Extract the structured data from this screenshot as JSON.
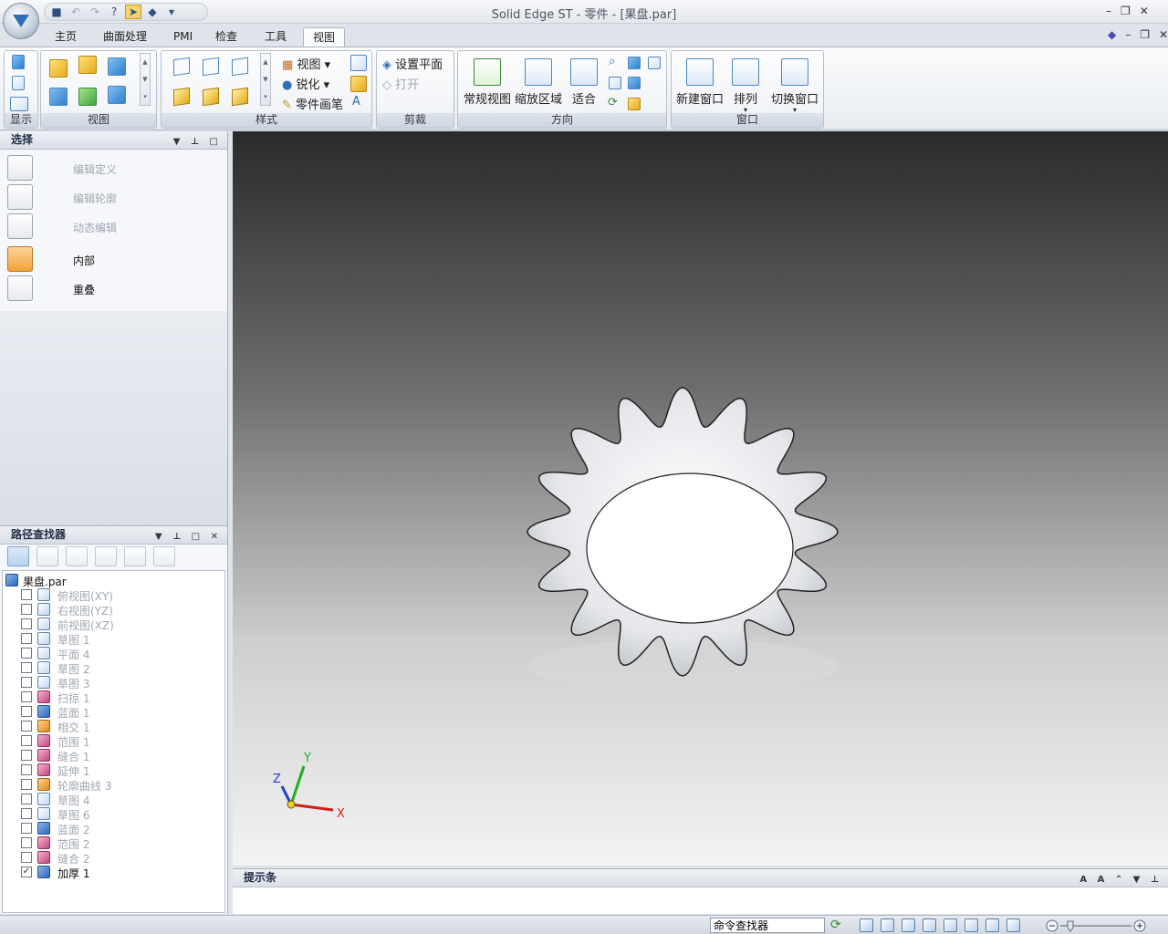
{
  "window": {
    "title": "Solid Edge ST - 零件 - [果盘.par]"
  },
  "tabs": [
    "主页",
    "曲面处理",
    "PMI",
    "检查",
    "工具",
    "视图"
  ],
  "active_tab": "视图",
  "ribbon": {
    "groups": {
      "display": "显示",
      "views": "视图",
      "styles": "样式",
      "clip": "剪裁",
      "orient": "方向",
      "window": "窗口"
    },
    "styles_buttons": {
      "view": "视图",
      "sharpen": "锐化",
      "part_painter": "零件画笔"
    },
    "clip_buttons": {
      "set_plane": "设置平面",
      "open": "打开"
    },
    "orient_buttons": {
      "common_views": "常规视图",
      "zoom_area": "缩放区域",
      "fit": "适合"
    },
    "window_buttons": {
      "new_window": "新建窗口",
      "arrange": "排列",
      "switch_window": "切换窗口"
    }
  },
  "select_panel": {
    "title": "选择",
    "items": [
      {
        "label": "编辑定义",
        "enabled": false
      },
      {
        "label": "编辑轮廓",
        "enabled": false
      },
      {
        "label": "动态编辑",
        "enabled": false
      },
      {
        "label": "内部",
        "enabled": true
      },
      {
        "label": "重叠",
        "enabled": true
      }
    ]
  },
  "path_finder": {
    "title": "路径查找器",
    "root": "果盘.par",
    "items": [
      {
        "label": "俯视图(XY)",
        "icon": "plane-icon"
      },
      {
        "label": "右视图(YZ)",
        "icon": "plane-icon"
      },
      {
        "label": "前视图(XZ)",
        "icon": "plane-icon"
      },
      {
        "label": "草图 1",
        "icon": "sketch-icon"
      },
      {
        "label": "平面 4",
        "icon": "plane-icon"
      },
      {
        "label": "草图 2",
        "icon": "sketch-icon"
      },
      {
        "label": "草图 3",
        "icon": "sketch-icon"
      },
      {
        "label": "扫掠 1",
        "icon": "sweep-icon"
      },
      {
        "label": "蓝面 1",
        "icon": "bluesurf-icon"
      },
      {
        "label": "相交 1",
        "icon": "intersect-icon"
      },
      {
        "label": "范围 1",
        "icon": "bound-icon"
      },
      {
        "label": "缝合 1",
        "icon": "stitch-icon"
      },
      {
        "label": "延伸 1",
        "icon": "extend-icon"
      },
      {
        "label": "轮廓曲线 3",
        "icon": "contour-icon"
      },
      {
        "label": "草图 4",
        "icon": "sketch-icon"
      },
      {
        "label": "草图 6",
        "icon": "sketch-icon"
      },
      {
        "label": "蓝面 2",
        "icon": "bluesurf-icon"
      },
      {
        "label": "范围 2",
        "icon": "bound-icon"
      },
      {
        "label": "缝合 2",
        "icon": "stitch-icon"
      },
      {
        "label": "加厚 1",
        "icon": "thicken-icon",
        "checked": true,
        "active": true
      }
    ]
  },
  "triad": {
    "x": "X",
    "y": "Y",
    "z": "Z"
  },
  "prompt_bar": {
    "title": "提示条"
  },
  "statusbar": {
    "command_finder": "命令查找器"
  },
  "colors": {
    "accent": "#2f7fcb",
    "highlight": "#f2a23a"
  }
}
